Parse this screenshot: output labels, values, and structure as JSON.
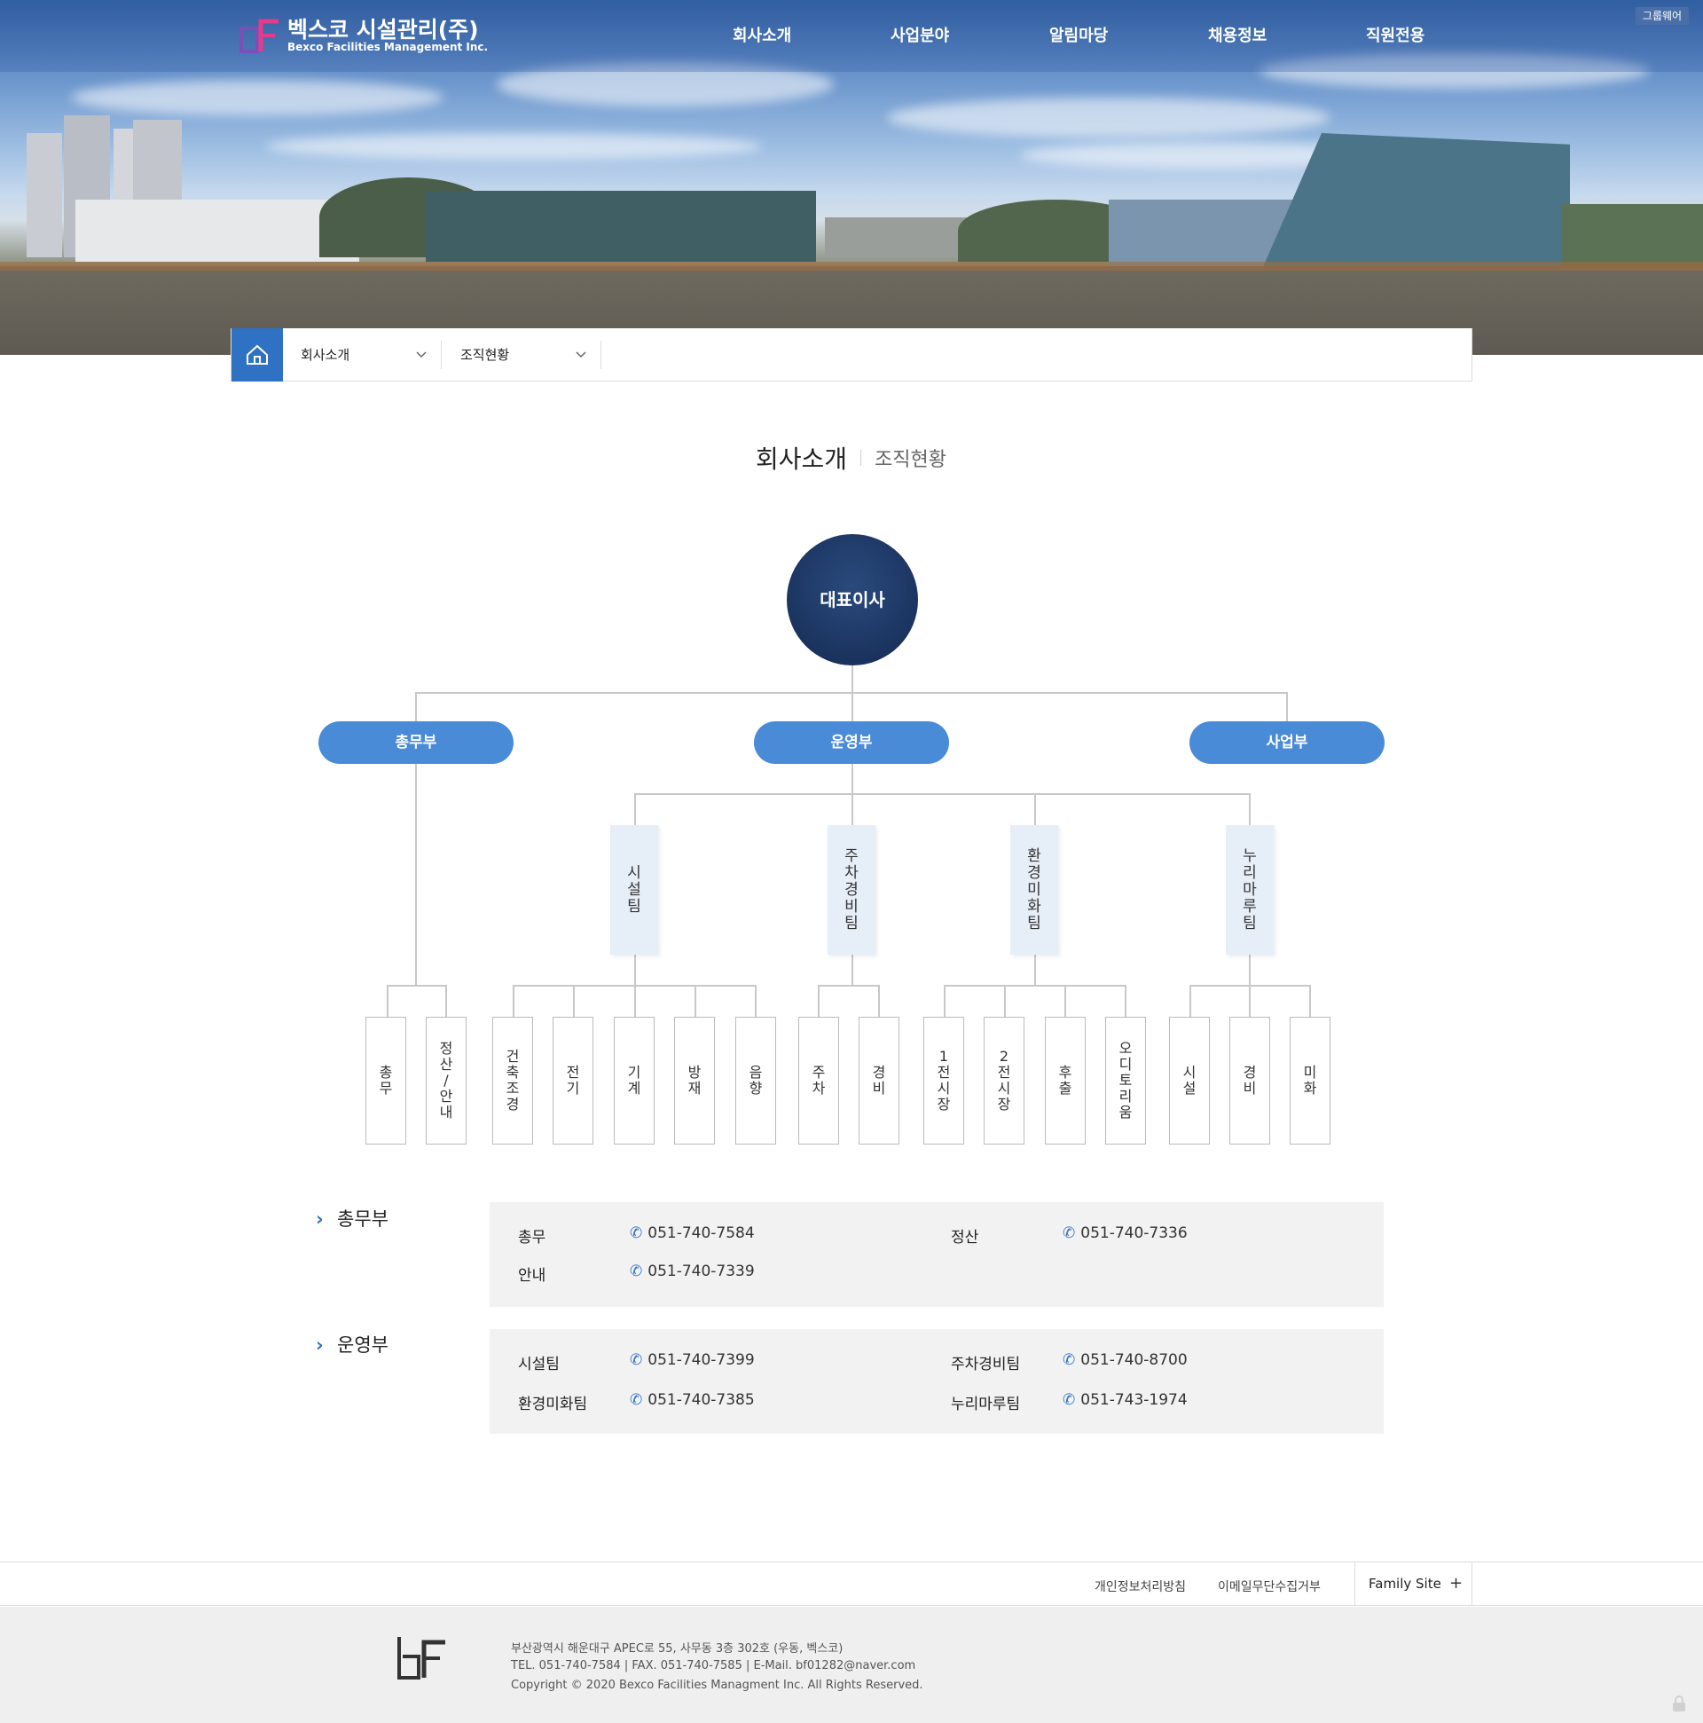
{
  "header": {
    "logo_ko": "벡스코 시설관리(주)",
    "logo_en": "Bexco Facilities Management Inc.",
    "nav": [
      "회사소개",
      "사업분야",
      "알림마당",
      "채용정보",
      "직원전용"
    ],
    "groupware": "그룹웨어"
  },
  "breadcrumb": {
    "level1": "회사소개",
    "level2": "조직현황"
  },
  "page": {
    "title": "회사소개",
    "subtitle": "조직현황"
  },
  "org": {
    "ceo": "대표이사",
    "departments": [
      "총무부",
      "운영부",
      "사업부"
    ],
    "teams": [
      "시설팀",
      "주차경비팀",
      "환경미화팀",
      "누리마루팀"
    ],
    "units": [
      "총무",
      "정산/안내",
      "건축조경",
      "전기",
      "기계",
      "방재",
      "음향",
      "주차",
      "경비",
      "1전시장",
      "2전시장",
      "후출",
      "오디토리움",
      "시설",
      "경비",
      "미화"
    ]
  },
  "contacts": [
    {
      "heading": "총무부",
      "rows": [
        {
          "label": "총무",
          "tel": "051-740-7584"
        },
        {
          "label": "정산",
          "tel": "051-740-7336"
        },
        {
          "label": "안내",
          "tel": "051-740-7339"
        }
      ]
    },
    {
      "heading": "운영부",
      "rows": [
        {
          "label": "시설팀",
          "tel": "051-740-7399"
        },
        {
          "label": "주차경비팀",
          "tel": "051-740-8700"
        },
        {
          "label": "환경미화팀",
          "tel": "051-740-7385"
        },
        {
          "label": "누리마루팀",
          "tel": "051-743-1974"
        }
      ]
    }
  ],
  "footer": {
    "links": [
      "개인정보처리방침",
      "이메일무단수집거부"
    ],
    "family": "Family Site",
    "address": "부산광역시 해운대구 APEC로 55, 사무동 3층 302호 (우동, 벡스코)",
    "contact": "TEL. 051-740-7584 | FAX. 051-740-7585 | E-Mail. bf01282@naver.com",
    "copyright": "Copyright © 2020 Bexco Facilities Managment Inc. All Rights Reserved."
  },
  "colors": {
    "accent": "#2f72c4",
    "dept": "#4a8bd8",
    "ceo": "#142a52",
    "team_bg": "#e6eef8"
  },
  "icons": [
    "home-icon",
    "chevron-down-icon",
    "phone-icon",
    "plus-icon",
    "lock-icon"
  ]
}
